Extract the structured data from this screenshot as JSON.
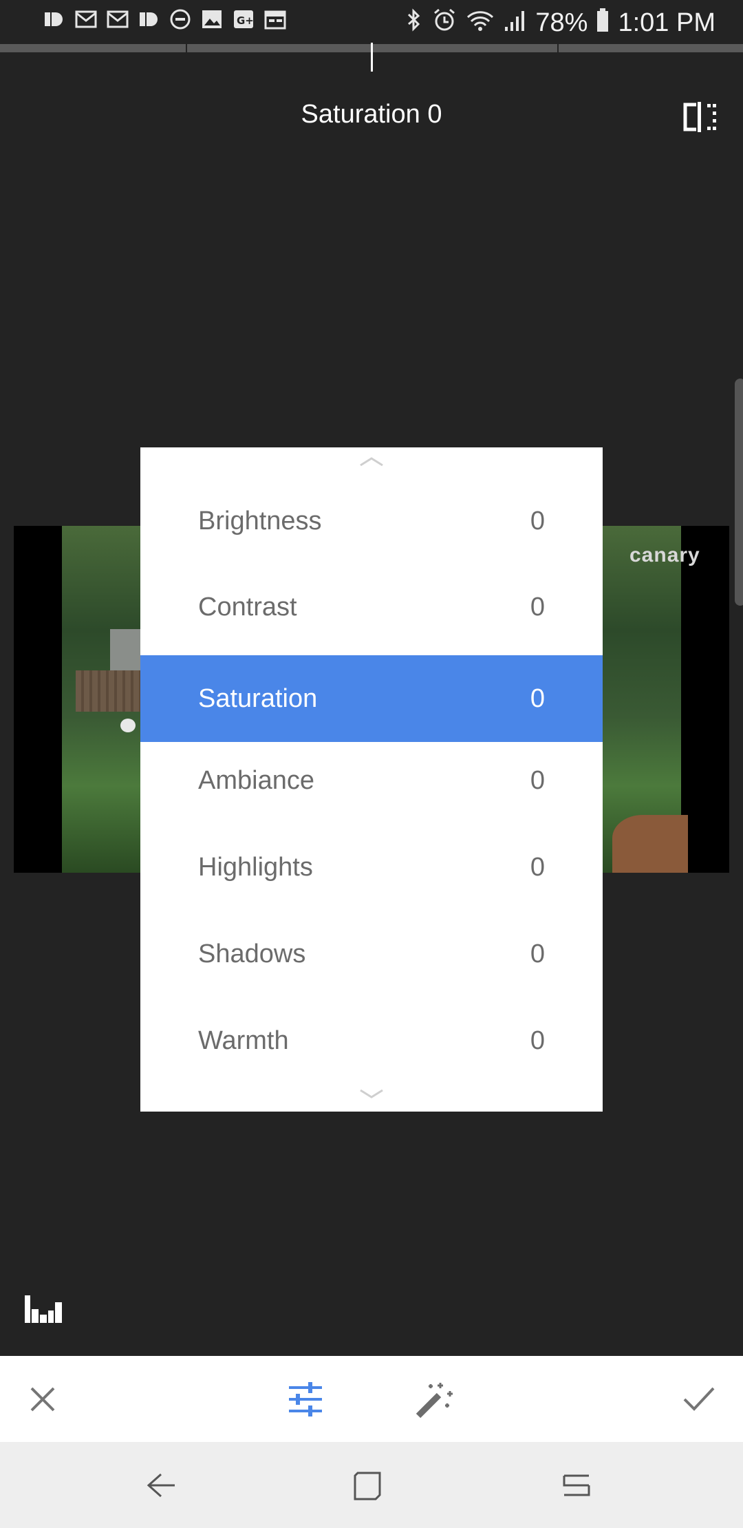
{
  "status_bar": {
    "battery_percent": "78%",
    "time": "1:01 PM",
    "left_icons": [
      "app-icon",
      "gmail-icon",
      "gmail-icon",
      "app-icon",
      "do-not-disturb-icon",
      "image-icon",
      "google-plus-icon",
      "calendar-icon"
    ],
    "right_icons": [
      "bluetooth-icon",
      "alarm-icon",
      "wifi-icon",
      "signal-icon",
      "battery-icon"
    ]
  },
  "header": {
    "title": "Saturation 0"
  },
  "photo": {
    "watermark": "canary"
  },
  "adjust_menu": {
    "items": [
      {
        "label": "Brightness",
        "value": "0"
      },
      {
        "label": "Contrast",
        "value": "0"
      },
      {
        "label": "Saturation",
        "value": "0",
        "selected": true
      },
      {
        "label": "Ambiance",
        "value": "0"
      },
      {
        "label": "Highlights",
        "value": "0"
      },
      {
        "label": "Shadows",
        "value": "0"
      },
      {
        "label": "Warmth",
        "value": "0"
      }
    ]
  },
  "toolbar": {
    "buttons": [
      "close-icon",
      "tune-icon",
      "auto-enhance-icon",
      "check-icon"
    ],
    "active_color": "#4a86e8"
  },
  "nav_bar": {
    "buttons": [
      "back-icon",
      "home-icon",
      "recents-icon"
    ]
  }
}
